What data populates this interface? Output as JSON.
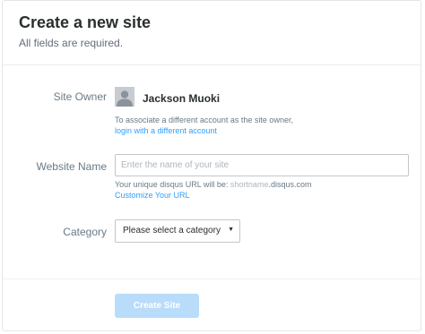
{
  "header": {
    "title": "Create a new site",
    "subtitle": "All fields are required."
  },
  "owner": {
    "label": "Site Owner",
    "avatar_icon": "user-avatar-icon",
    "name": "Jackson Muoki",
    "help_text": "To associate a different account as the site owner,",
    "login_link": "login with a different account"
  },
  "website": {
    "label": "Website Name",
    "placeholder": "Enter the name of your site",
    "value": "",
    "url_prefix": "Your unique disqus URL will be: ",
    "url_shortname": "shortname",
    "url_suffix": ".disqus.com",
    "customize_link": "Customize Your URL"
  },
  "category": {
    "label": "Category",
    "selected": "Please select a category",
    "arrow_icon": "caret-down-icon"
  },
  "footer": {
    "create_label": "Create Site"
  },
  "colors": {
    "link": "#2e9fff",
    "button_disabled": "#b9dcfb",
    "label": "#687a86",
    "text": "#2a2e2e"
  }
}
